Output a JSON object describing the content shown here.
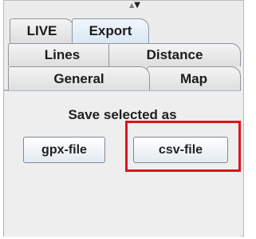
{
  "tabs": {
    "row1": [
      {
        "label": "LIVE",
        "selected": false
      },
      {
        "label": "Export",
        "selected": true
      }
    ],
    "row2": [
      {
        "label": "Lines",
        "selected": false
      },
      {
        "label": "Distance",
        "selected": false
      }
    ],
    "row3": [
      {
        "label": "General",
        "selected": false
      },
      {
        "label": "Map",
        "selected": false
      }
    ]
  },
  "panel": {
    "label": "Save selected as",
    "buttons": {
      "gpx": "gpx-file",
      "csv": "csv-file"
    }
  },
  "scroll_arrows": {
    "up": "▲",
    "down": "▼"
  },
  "colors": {
    "highlight": "#e0131d",
    "selected_tab": "#dbe7f2",
    "panel_border": "#a9b6c6"
  }
}
